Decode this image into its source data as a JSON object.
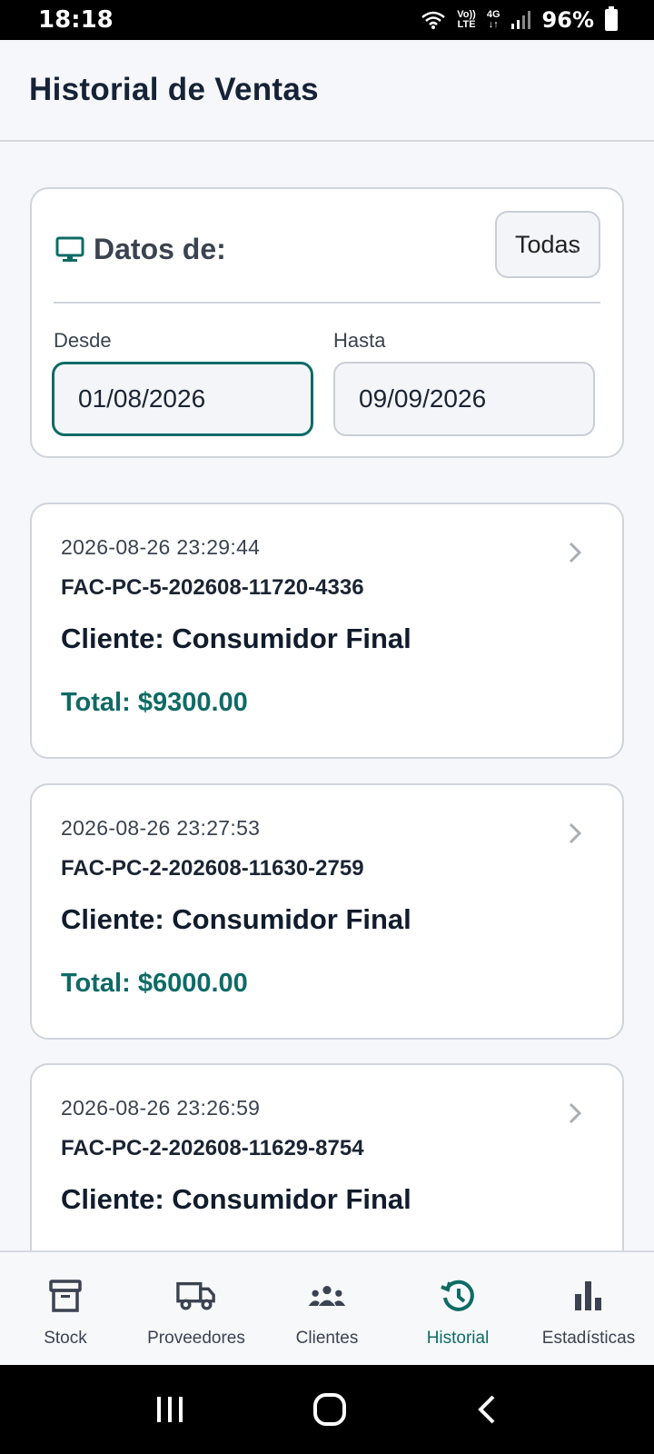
{
  "status_bar": {
    "time": "18:18",
    "network_top": "Vo))",
    "network_bottom": "LTE",
    "network_type": "4G",
    "battery": "96%"
  },
  "header": {
    "title": "Historial de Ventas"
  },
  "filter": {
    "label": "Datos de:",
    "select_value": "Todas",
    "from_label": "Desde",
    "from_value": "01/08/2026",
    "to_label": "Hasta",
    "to_value": "09/09/2026"
  },
  "sales": [
    {
      "date": "2026-08-26 23:29:44",
      "invoice": "FAC-PC-5-202608-11720-4336",
      "client": "Cliente: Consumidor Final",
      "total": "Total: $9300.00"
    },
    {
      "date": "2026-08-26 23:27:53",
      "invoice": "FAC-PC-2-202608-11630-2759",
      "client": "Cliente: Consumidor Final",
      "total": "Total: $6000.00"
    },
    {
      "date": "2026-08-26 23:26:59",
      "invoice": "FAC-PC-2-202608-11629-8754",
      "client": "Cliente: Consumidor Final",
      "total": ""
    }
  ],
  "bottom_nav": {
    "items": [
      {
        "label": "Stock",
        "icon": "archive-icon"
      },
      {
        "label": "Proveedores",
        "icon": "truck-icon"
      },
      {
        "label": "Clientes",
        "icon": "group-icon"
      },
      {
        "label": "Historial",
        "icon": "history-icon",
        "active": true
      },
      {
        "label": "Estadísticas",
        "icon": "bar-chart-icon"
      }
    ]
  },
  "colors": {
    "accent": "#0e6b66",
    "text_dark": "#111c2d",
    "background": "#f5f7fa"
  }
}
